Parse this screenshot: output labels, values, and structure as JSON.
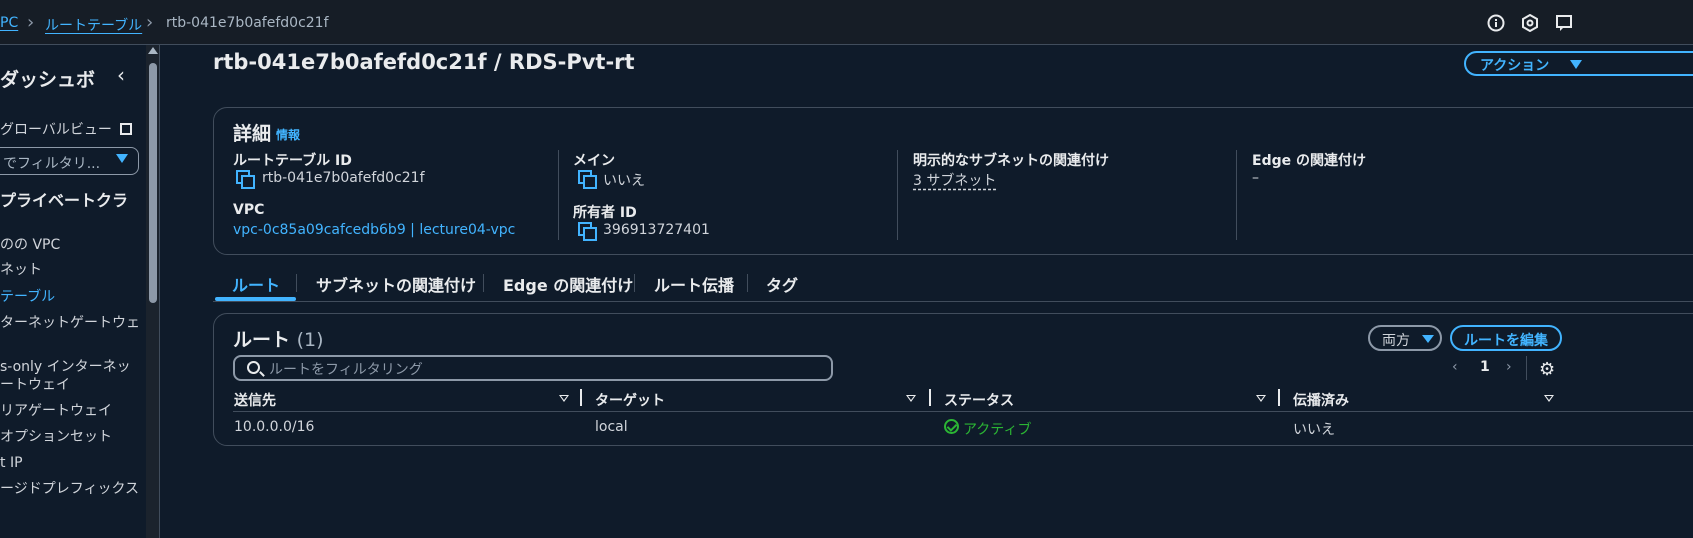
{
  "breadcrumb": {
    "vpc": "PC",
    "route_tables": "ルートテーブル",
    "current": "rtb-041e7b0afefd0c21f"
  },
  "top_icons": [
    "info-icon",
    "notifications-icon",
    "feedback-icon"
  ],
  "sidebar": {
    "title": "ダッシュボ",
    "global_view": "グローバルビュー",
    "filter_value": "でフィルタリ...",
    "section": "プライベートクラ",
    "items": [
      {
        "label": "のの VPC",
        "active": false
      },
      {
        "label": "ネット",
        "active": false
      },
      {
        "label": "テーブル",
        "active": true
      },
      {
        "label": "ターネットゲートウェ",
        "active": false
      },
      {
        "label": "s-only インターネッ",
        "active": false
      },
      {
        "label": "ートウェイ",
        "active": false
      },
      {
        "label": "リアゲートウェイ",
        "active": false
      },
      {
        "label": "オプションセット",
        "active": false
      },
      {
        "label": "t IP",
        "active": false
      },
      {
        "label": "ージドプレフィックス",
        "active": false
      }
    ]
  },
  "page": {
    "title": "rtb-041e7b0afefd0c21f / RDS-Pvt-rt",
    "actions_label": "アクション"
  },
  "details": {
    "heading": "詳細",
    "info_link": "情報",
    "route_table_id_label": "ルートテーブル ID",
    "route_table_id": "rtb-041e7b0afefd0c21f",
    "vpc_label": "VPC",
    "vpc_value": "vpc-0c85a09cafcedb6b9 | lecture04-vpc",
    "main_label": "メイン",
    "main_value": "いいえ",
    "owner_label": "所有者 ID",
    "owner_value": "396913727401",
    "explicit_assoc_label": "明示的なサブネットの関連付け",
    "explicit_assoc_value": "3 サブネット",
    "edge_assoc_label": "Edge の関連付け",
    "edge_assoc_value": "–"
  },
  "tabs": [
    {
      "label": "ルート",
      "active": true
    },
    {
      "label": "サブネットの関連付け",
      "active": false
    },
    {
      "label": "Edge の関連付け",
      "active": false
    },
    {
      "label": "ルート伝播",
      "active": false
    },
    {
      "label": "タグ",
      "active": false
    }
  ],
  "routes": {
    "heading": "ルート",
    "count": "(1)",
    "filter_select": "両方",
    "edit_button": "ルートを編集",
    "search_placeholder": "ルートをフィルタリング",
    "page_current": "1",
    "columns": [
      "送信先",
      "ターゲット",
      "ステータス",
      "伝播済み"
    ],
    "rows": [
      {
        "destination": "10.0.0.0/16",
        "target": "local",
        "status": "アクティブ",
        "propagated": "いいえ"
      }
    ],
    "status_color": "#2bb534"
  }
}
